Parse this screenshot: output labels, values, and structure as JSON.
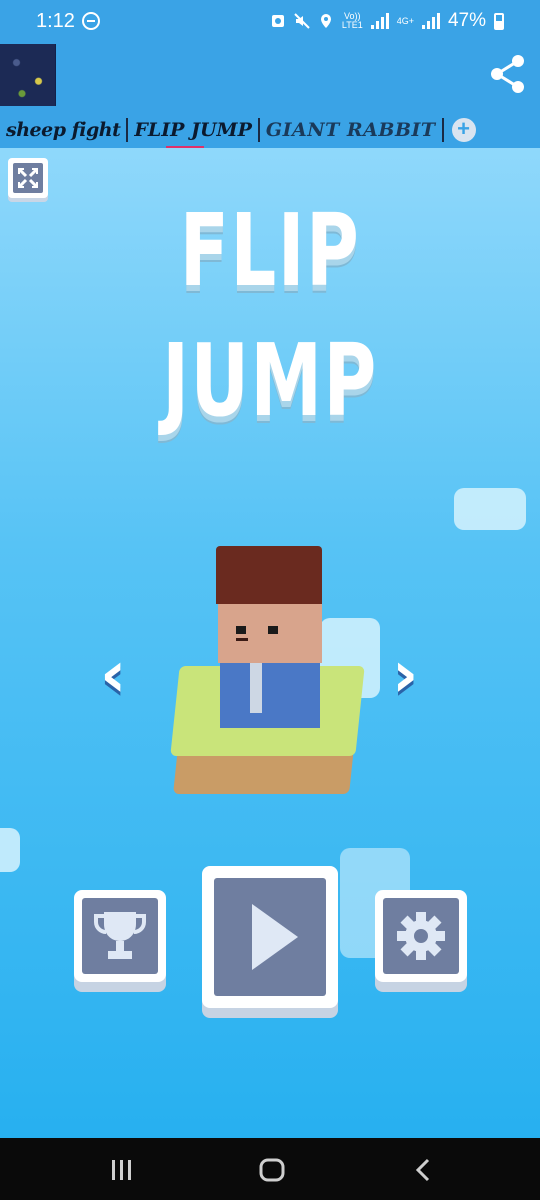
{
  "status_bar": {
    "time": "1:12",
    "network_label_top": "Vo))",
    "network_label_bottom": "LTE1",
    "net_gen": "4G+",
    "battery": "47%"
  },
  "tabs": [
    {
      "label": "sheep fight"
    },
    {
      "label": "FLIP JUMP"
    },
    {
      "label": "GIANT RABBIT"
    }
  ],
  "tab_add_label": "+",
  "game": {
    "title_line1": "FLIP",
    "title_line2": "JUMP",
    "prev_arrow": "‹",
    "next_arrow": "›"
  },
  "colors": {
    "accent": "#3aa3e6",
    "sky_top": "#8fd8fb",
    "sky_bottom": "#27b0f0",
    "active_tab_indicator": "#e0306a",
    "button_face": "#6f7ea0"
  },
  "icons": [
    "share-icon",
    "fullscreen-icon",
    "trophy-icon",
    "play-icon",
    "gear-icon",
    "recents-icon",
    "home-icon",
    "back-icon"
  ]
}
